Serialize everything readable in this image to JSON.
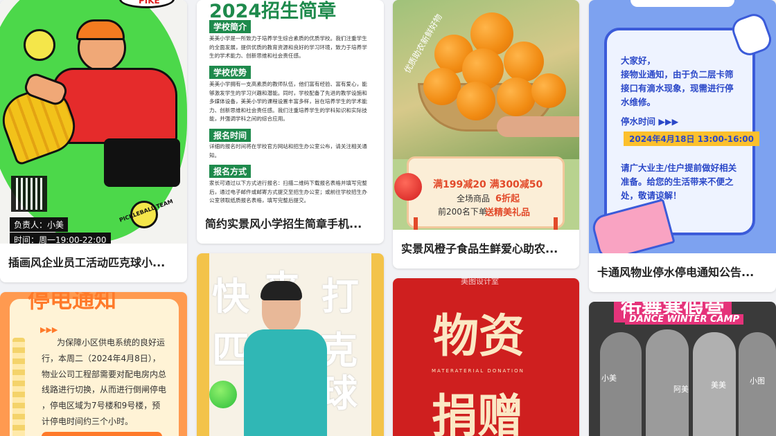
{
  "cards": [
    {
      "title": "插画风企业员工活动匹克球小...",
      "thumb": {
        "top_badge": "PIKE",
        "team_text": "PICKLEBALL TEAM",
        "lead": "负责人：小美",
        "time": "时间：周一19:00-22:00"
      }
    },
    {
      "title": "简约实景风小学招生简章手机...",
      "thumb": {
        "heading": "2024招生简章",
        "sections": [
          {
            "label": "学校简介",
            "text": "美美小学是一所致力于培养学生综合素质的优质学校。我们注重学生的全面发展，提供优质的教育资源和良好的学习环境，致力于培养学生的学术能力、创新思维和社会责任感。"
          },
          {
            "label": "学校优势",
            "text": "美美小学拥有一支高素质的教师队伍，他们富有经验、富有爱心，能够激发学生的学习兴趣和潜能。同时，学校配备了先进的教学设施和多媒体设备，美美小学的课程设置丰富多样，旨在培养学生的学术能力、创新思维和社会责任感。我们注重培养学生的学科知识和实际技能，并强调学科之间的综合应用。"
          },
          {
            "label": "报名时间",
            "text": "详细的报名时间将在学校官方网站和招生办公室公布，请关注相关通知。"
          },
          {
            "label": "报名方式",
            "text": "家长可通过以下方式进行报名：扫描二维码下载报名表格并填写完整后，通过电子邮件或邮寄方式提交至招生办公室；或前往学校招生办公室领取纸质报名表格，填写完整后提交。"
          }
        ]
      }
    },
    {
      "title": "实景风橙子食品生鲜爱心助农...",
      "thumb": {
        "vertical_text": "优质助农新鲜好物",
        "promo_line1": "满199减20 满300减50",
        "promo_line2_prefix": "全场商品",
        "promo_discount": "6折起",
        "promo_line3_prefix": "前200名下单",
        "promo_gift": "送精美礼品"
      }
    },
    {
      "title": "卡通风物业停水停电通知公告...",
      "thumb": {
        "lines": [
          "大家好，",
          "接物业通知，由于负二层卡筛",
          "接口有滴水现象，现需进行停",
          "水维修。"
        ],
        "time_label": "停水时间 ▶▶▶",
        "time_value": "2024年4月18日 13:00-16:00",
        "closing": [
          "请广大业主/住户提前做好相关",
          "准备。给您的生活带来不便之",
          "处，敬请谅解！"
        ]
      }
    },
    {
      "title": "",
      "thumb": {
        "heading": "停电通知",
        "arrows": "▶▶▶",
        "lines": [
          "为保障小区供电系统的良好运",
          "行，本周二（2024年4月8日），",
          "物业公司工程部需要对配电房内总",
          "线路进行切换，从而进行倒闸停电",
          "，停电区域为7号楼和9号楼，预",
          "计停电时间约三个小时。"
        ]
      }
    },
    {
      "title": "",
      "thumb": {
        "big_chars": [
          "快",
          "来",
          "打",
          "匹",
          "克",
          "球"
        ]
      }
    },
    {
      "title": "",
      "thumb": {
        "brand": "美图设计室",
        "big1": "物资",
        "sub": "MATERATERIAL DONATION",
        "big2": "捐赠"
      }
    },
    {
      "title": "",
      "thumb": {
        "heading": "街舞寒假营",
        "sub": "DANCE WINTER CAMP",
        "names": [
          "小美",
          "阿美",
          "美美",
          "小图"
        ]
      }
    }
  ],
  "colors": {
    "green": "#1e8a4c",
    "orange_red": "#e24a2a",
    "notice_blue": "#2b48c8",
    "red": "#cf1f1f"
  }
}
